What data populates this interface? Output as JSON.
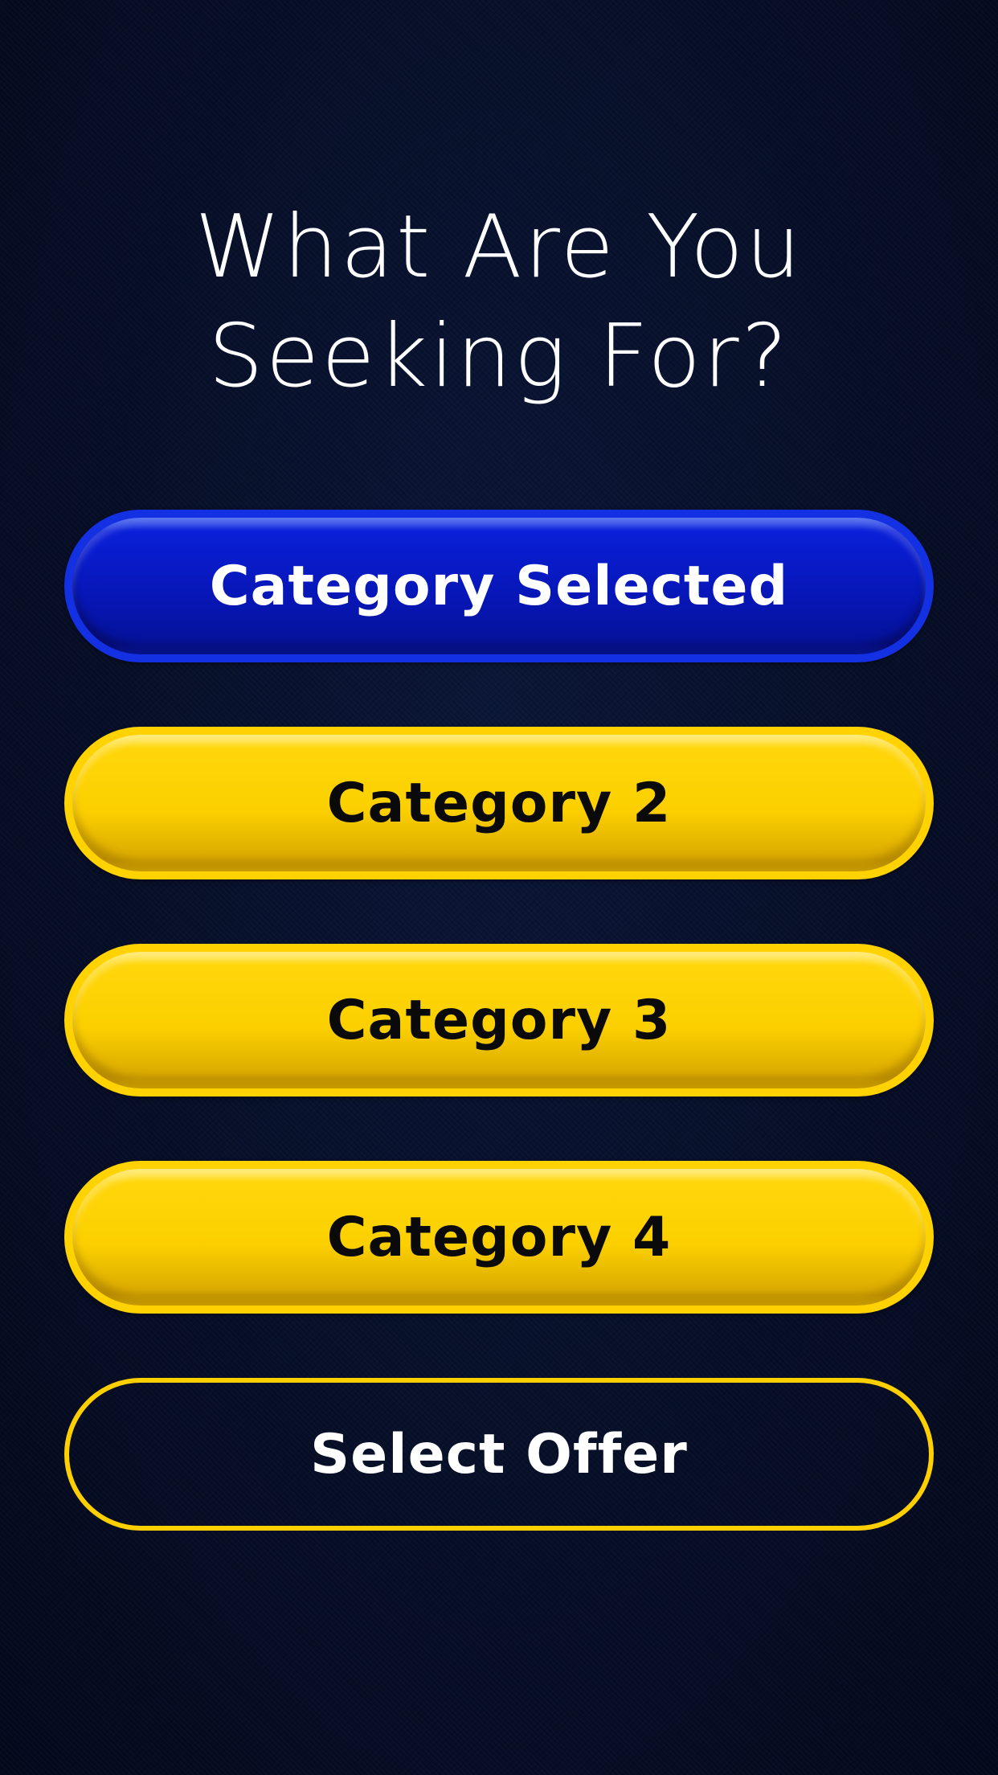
{
  "header": {
    "title_line1": "What Are You",
    "title_line2": "Seeking For?"
  },
  "options": [
    {
      "label": "Category Selected",
      "state": "selected"
    },
    {
      "label": "Category 2",
      "state": "unselected"
    },
    {
      "label": "Category 3",
      "state": "unselected"
    },
    {
      "label": "Category 4",
      "state": "unselected"
    }
  ],
  "action": {
    "label": "Select Offer"
  },
  "colors": {
    "background": "#07102a",
    "selected": "#0a1fd8",
    "accent": "#ffd200",
    "title_text": "#ffffff"
  }
}
